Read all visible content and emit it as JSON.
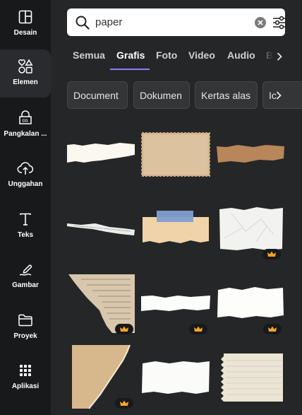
{
  "sidebar": {
    "items": [
      {
        "label": "Desain",
        "icon": "layout-icon"
      },
      {
        "label": "Elemen",
        "icon": "shapes-icon"
      },
      {
        "label": "Pangkalan ...",
        "icon": "brand-icon"
      },
      {
        "label": "Unggahan",
        "icon": "cloud-upload-icon"
      },
      {
        "label": "Teks",
        "icon": "text-icon"
      },
      {
        "label": "Gambar",
        "icon": "draw-icon"
      },
      {
        "label": "Proyek",
        "icon": "folder-icon"
      },
      {
        "label": "Aplikasi",
        "icon": "apps-icon"
      }
    ],
    "active_index": 1
  },
  "search": {
    "value": "paper",
    "icon": "search-icon"
  },
  "tabs": [
    "Semua",
    "Grafis",
    "Foto",
    "Video",
    "Audio",
    "B"
  ],
  "active_tab": "Grafis",
  "chips": [
    "Document",
    "Dokumen",
    "Kertas alas",
    "Ic"
  ],
  "colors": {
    "accent": "#8b7bff",
    "crown": "#f5a623",
    "panel": "#252627",
    "sidebar": "#18191b"
  },
  "results": [
    {
      "name": "white-torn-strip",
      "premium": false
    },
    {
      "name": "stamp-paper",
      "premium": false
    },
    {
      "name": "brown-kraft-strip",
      "premium": false
    },
    {
      "name": "newspaper-torn-strip",
      "premium": false
    },
    {
      "name": "taped-paper-note",
      "premium": false
    },
    {
      "name": "crumpled-white-paper",
      "premium": true
    },
    {
      "name": "old-manuscript-corner",
      "premium": true
    },
    {
      "name": "white-torn-band",
      "premium": true
    },
    {
      "name": "white-torn-piece",
      "premium": true
    },
    {
      "name": "aged-paper-triangle",
      "premium": true
    },
    {
      "name": "white-ripped-paper",
      "premium": false
    },
    {
      "name": "lined-notebook-page",
      "premium": false
    }
  ]
}
